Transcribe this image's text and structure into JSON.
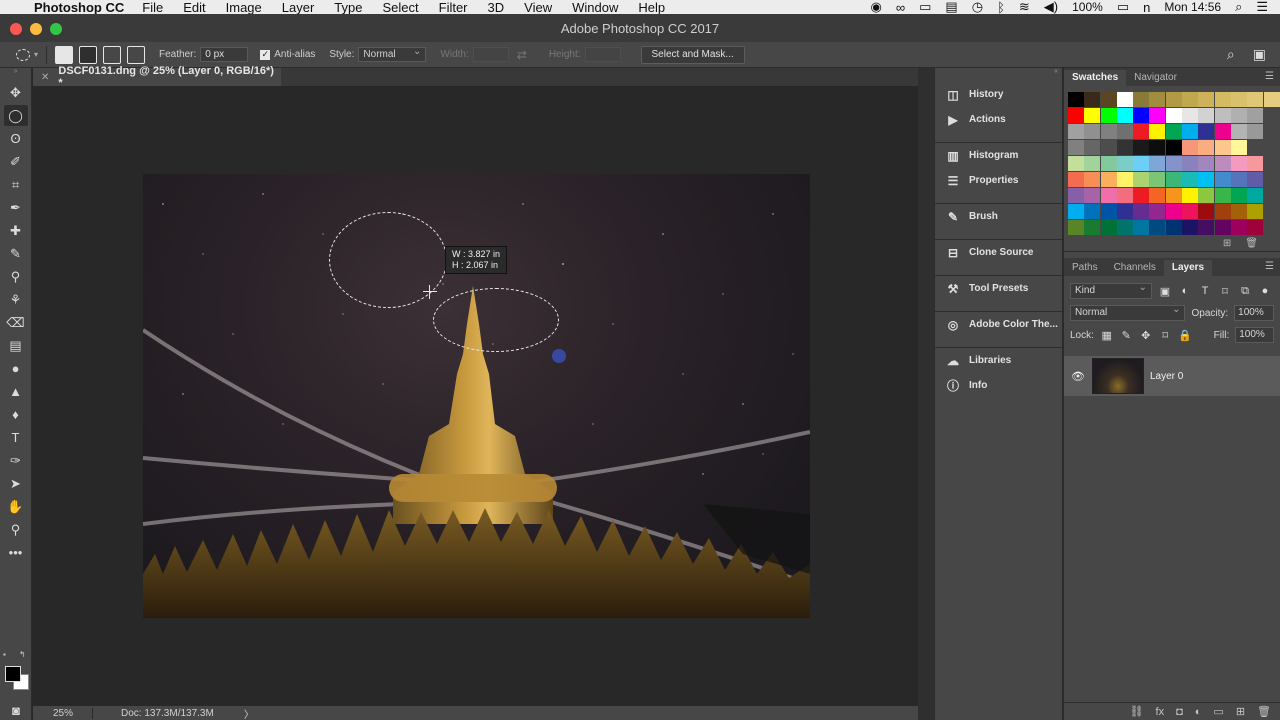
{
  "menubar": {
    "app_name": "Photoshop CC",
    "items": [
      "File",
      "Edit",
      "Image",
      "Layer",
      "Type",
      "Select",
      "Filter",
      "3D",
      "View",
      "Window",
      "Help"
    ],
    "battery": "100%",
    "clock": "Mon 14:56"
  },
  "window": {
    "title": "Adobe Photoshop CC 2017",
    "colors": {
      "close": "#fc5753",
      "minimize": "#fdbc40",
      "zoom": "#33c748"
    }
  },
  "options": {
    "feather_label": "Feather:",
    "feather_value": "0 px",
    "antialias_label": "Anti-alias",
    "style_label": "Style:",
    "style_value": "Normal",
    "width_label": "Width:",
    "height_label": "Height:",
    "select_mask_label": "Select and Mask..."
  },
  "document": {
    "tab_title": "DSCF0131.dng @ 25% (Layer 0, RGB/16*) *",
    "measure_w": "W : 3.827 in",
    "measure_h": "H : 2.067 in"
  },
  "status": {
    "zoom": "25%",
    "doc": "Doc: 137.3M/137.3M",
    "arrow": "〉"
  },
  "panel_icons": [
    {
      "label": "History",
      "icon": "history-icon",
      "glyph": "◫"
    },
    {
      "label": "Actions",
      "icon": "actions-icon",
      "glyph": "▶"
    },
    {
      "label": "Histogram",
      "icon": "histogram-icon",
      "glyph": "▥"
    },
    {
      "label": "Properties",
      "icon": "properties-icon",
      "glyph": "☰"
    },
    {
      "label": "Brush",
      "icon": "brush-icon",
      "glyph": "✎"
    },
    {
      "label": "Clone Source",
      "icon": "clone-source-icon",
      "glyph": "⊟"
    },
    {
      "label": "Tool Presets",
      "icon": "tool-presets-icon",
      "glyph": "⚒"
    },
    {
      "label": "Adobe Color The...",
      "icon": "adobe-color-icon",
      "glyph": "◎"
    },
    {
      "label": "Libraries",
      "icon": "libraries-icon",
      "glyph": "☁"
    },
    {
      "label": "Info",
      "icon": "info-icon",
      "glyph": "ⓘ"
    }
  ],
  "swatch_tabs": [
    "Swatches",
    "Navigator"
  ],
  "layer_tabs": [
    "Paths",
    "Channels",
    "Layers"
  ],
  "layers": {
    "kind_label": "Kind",
    "blend_mode": "Normal",
    "opacity_label": "Opacity:",
    "opacity_value": "100%",
    "lock_label": "Lock:",
    "fill_label": "Fill:",
    "fill_value": "100%",
    "layer_name": "Layer 0"
  },
  "swatches": [
    [
      "#000000",
      "#3a2a1a",
      "#5a4620",
      "#ffffff",
      "#8a7a3a",
      "#a08d3d",
      "#b09a46",
      "#c0a84f",
      "#cdb25a",
      "#d4bb62",
      "#d9c16b",
      "#dfc775",
      "#e4cd7f"
    ],
    [
      "#ff0000",
      "#ffff00",
      "#00ff00",
      "#00ffff",
      "#0000ff",
      "#ff00ff",
      "#ffffff",
      "#e6e6e6",
      "#d2d2d2",
      "#bebebe",
      "#b0b0b0",
      "#a0a0a0"
    ],
    [
      "#a0a0a0",
      "#909090",
      "#808080",
      "#707070",
      "#ed1c24",
      "#fff200",
      "#00a651",
      "#00aeef",
      "#2e3192",
      "#ec008c",
      "#b3b3b3",
      "#999999"
    ],
    [
      "#808080",
      "#666666",
      "#4d4d4d",
      "#333333",
      "#1a1a1a",
      "#0d0d0d",
      "#000000",
      "#f7977a",
      "#f9ad81",
      "#fdc68a",
      "#fff79a"
    ],
    [
      "#c4df9b",
      "#a3d39c",
      "#82ca9d",
      "#7bcdc8",
      "#6ecff6",
      "#7ea7d8",
      "#8493ca",
      "#8882be",
      "#a187be",
      "#bc8cbf",
      "#f49ac1",
      "#f6989d"
    ],
    [
      "#f26c4f",
      "#f68e55",
      "#fbaf5c",
      "#fff467",
      "#acd372",
      "#7cc576",
      "#3bb878",
      "#1abbb4",
      "#00bff3",
      "#438ccb",
      "#5574b9",
      "#605ca8"
    ],
    [
      "#855fa8",
      "#a763a8",
      "#f06eaa",
      "#f26d7d",
      "#ed1c24",
      "#f26522",
      "#f7941d",
      "#fff200",
      "#8dc73f",
      "#39b54a",
      "#00a651",
      "#00a99d"
    ],
    [
      "#00aeef",
      "#0072bc",
      "#0054a6",
      "#2e3192",
      "#662d91",
      "#92278f",
      "#ec008c",
      "#ed145b",
      "#9e0b0f",
      "#a0410d",
      "#a3620a",
      "#aba000"
    ],
    [
      "#598527",
      "#197b30",
      "#007236",
      "#00746b",
      "#0076a3",
      "#004a80",
      "#003471",
      "#1b1464",
      "#440e62",
      "#630460",
      "#9e005d",
      "#9e0039"
    ]
  ]
}
